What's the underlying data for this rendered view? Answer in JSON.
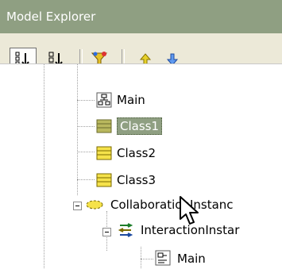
{
  "window": {
    "title": "Model Explorer"
  },
  "toolbar": {
    "buttons": [
      {
        "name": "sort-ascending",
        "icon": "sort-ascending-icon"
      },
      {
        "name": "sort-alphabetical",
        "icon": "sort-alphabetical-icon"
      },
      {
        "name": "filter",
        "icon": "filter-icon"
      },
      {
        "name": "move-up",
        "icon": "up-arrow-icon"
      },
      {
        "name": "move-down",
        "icon": "down-arrow-icon"
      }
    ]
  },
  "tree": {
    "items": [
      {
        "label": "Main",
        "icon": "diagram-icon"
      },
      {
        "label": "Class1",
        "icon": "class-icon",
        "selected": true
      },
      {
        "label": "Class2",
        "icon": "class-icon"
      },
      {
        "label": "Class3",
        "icon": "class-icon"
      },
      {
        "label": "CollaborationInstanc",
        "icon": "collaboration-icon",
        "expanded": true
      },
      {
        "label": "InteractionInstar",
        "icon": "interaction-icon",
        "expanded": true
      },
      {
        "label": "Main",
        "icon": "diagram-icon"
      }
    ]
  },
  "colors": {
    "title_bar": "#8f9f82",
    "toolbar": "#ece9d8",
    "selection": "#8f9f82",
    "class_icon": "#f5e24a",
    "arrow_up": "#c9b200",
    "arrow_down": "#3a78d8"
  }
}
